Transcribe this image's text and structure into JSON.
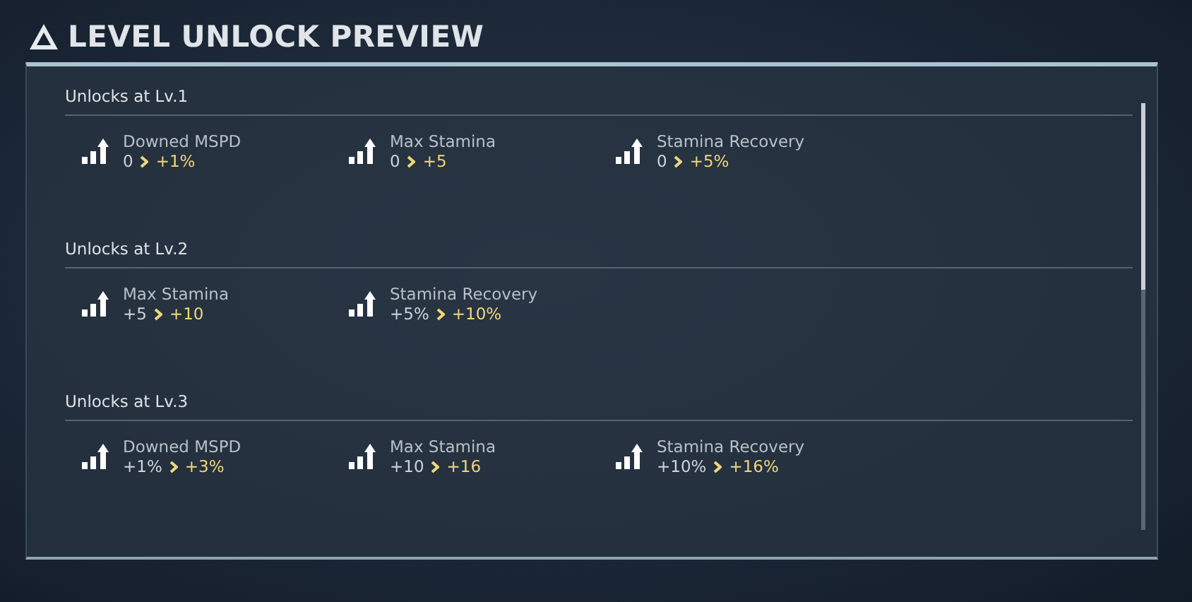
{
  "title": "LEVEL UNLOCK PREVIEW",
  "sections": [
    {
      "heading": "Unlocks at Lv.1",
      "items": [
        {
          "name": "Downed MSPD",
          "from": "0",
          "to": "+1%"
        },
        {
          "name": "Max Stamina",
          "from": "0",
          "to": "+5"
        },
        {
          "name": "Stamina Recovery",
          "from": "0",
          "to": "+5%"
        }
      ]
    },
    {
      "heading": "Unlocks at Lv.2",
      "items": [
        {
          "name": "Max Stamina",
          "from": "+5",
          "to": "+10"
        },
        {
          "name": "Stamina Recovery",
          "from": "+5%",
          "to": "+10%"
        }
      ]
    },
    {
      "heading": "Unlocks at Lv.3",
      "items": [
        {
          "name": "Downed MSPD",
          "from": "+1%",
          "to": "+3%"
        },
        {
          "name": "Max Stamina",
          "from": "+10",
          "to": "+16"
        },
        {
          "name": "Stamina Recovery",
          "from": "+10%",
          "to": "+16%"
        }
      ]
    }
  ]
}
